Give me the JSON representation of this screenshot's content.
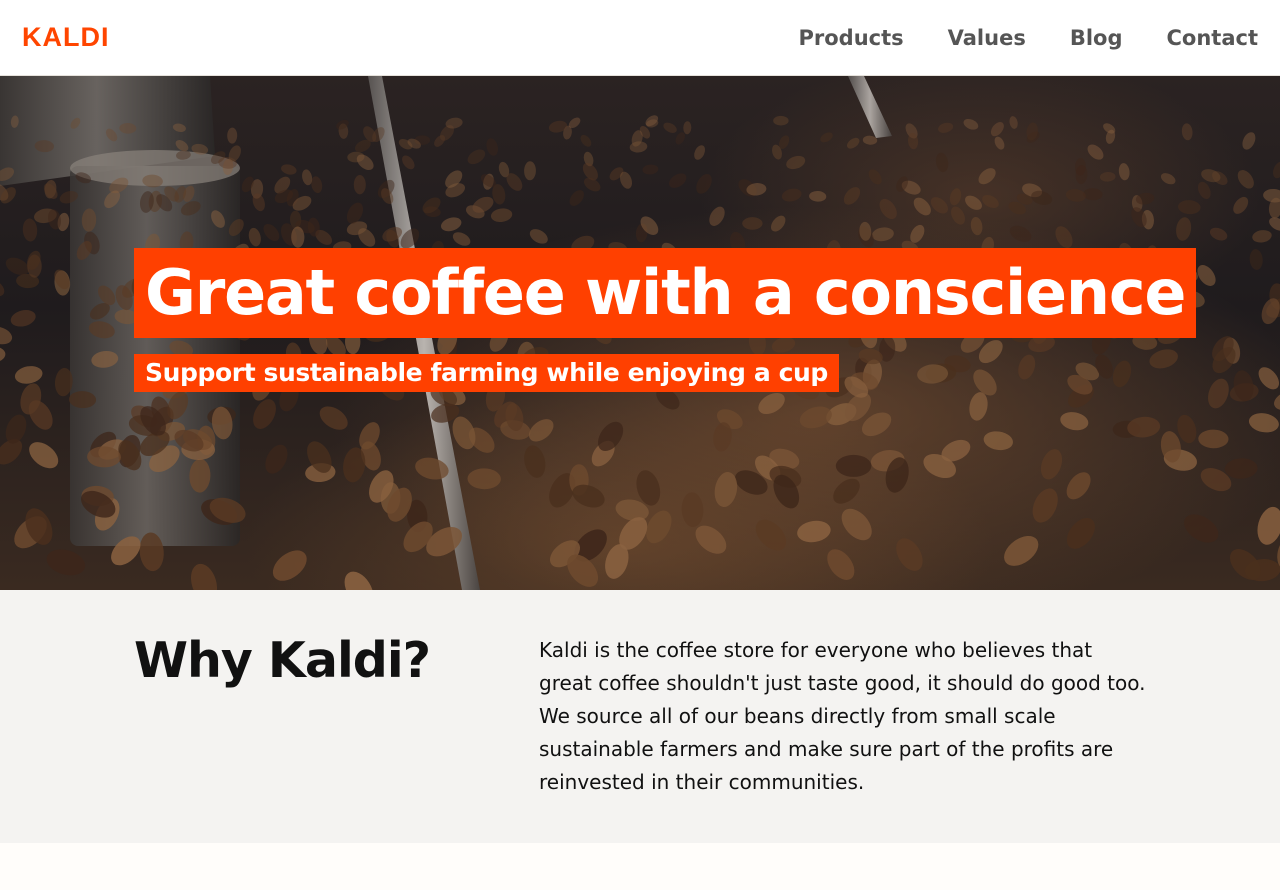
{
  "header": {
    "logo": "KALDI",
    "nav": [
      {
        "label": "Products"
      },
      {
        "label": "Values"
      },
      {
        "label": "Blog"
      },
      {
        "label": "Contact"
      }
    ]
  },
  "hero": {
    "title": "Great coffee with a conscience",
    "subtitle": "Support sustainable farming while enjoying a cup"
  },
  "why": {
    "title": "Why Kaldi?",
    "text": "Kaldi is the coffee store for everyone who believes that great coffee shouldn't just taste good, it should do good too. We source all of our beans directly from small scale sustainable farmers and make sure part of the profits are reinvested in their communities."
  },
  "colors": {
    "brand": "#ff4500",
    "highlight": "#ff4000",
    "nav_text": "#555555",
    "section_bg": "#f4f3f1"
  }
}
